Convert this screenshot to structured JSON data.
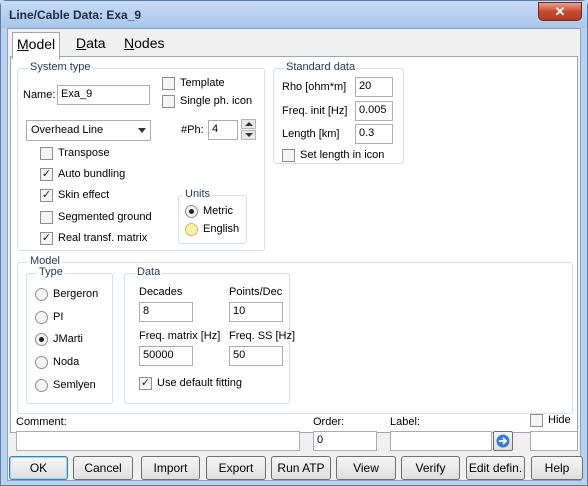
{
  "window": {
    "title": "Line/Cable Data: Exa_9",
    "close_glyph": "✕"
  },
  "tabs": [
    "Model",
    "Data",
    "Nodes"
  ],
  "system_type": {
    "title": "System type",
    "name_label": "Name:",
    "name_value": "Exa_9",
    "template_label": "Template",
    "single_phase_label": "Single ph. icon",
    "line_type": "Overhead Line",
    "phases_label": "#Ph:",
    "phases_value": "4",
    "checks": [
      {
        "label": "Transpose",
        "checked": false
      },
      {
        "label": "Auto bundling",
        "checked": true
      },
      {
        "label": "Skin effect",
        "checked": true
      },
      {
        "label": "Segmented ground",
        "checked": false
      },
      {
        "label": "Real transf. matrix",
        "checked": true
      }
    ],
    "units": {
      "title": "Units",
      "options": [
        "Metric",
        "English"
      ],
      "selected": "Metric"
    }
  },
  "standard_data": {
    "title": "Standard data",
    "rho_label": "Rho [ohm*m]",
    "rho_value": "20",
    "freq_init_label": "Freq. init [Hz]",
    "freq_init_value": "0.005",
    "length_label": "Length [km]",
    "length_value": "0.3",
    "set_length_label": "Set length in icon"
  },
  "model": {
    "title": "Model",
    "type": {
      "title": "Type",
      "options": [
        "Bergeron",
        "PI",
        "JMarti",
        "Noda",
        "Semlyen"
      ],
      "selected": "JMarti"
    },
    "data": {
      "title": "Data",
      "decades_label": "Decades",
      "decades_value": "8",
      "points_label": "Points/Dec",
      "points_value": "10",
      "freq_matrix_label": "Freq. matrix [Hz]",
      "freq_matrix_value": "50000",
      "freq_ss_label": "Freq. SS [Hz]",
      "freq_ss_value": "50",
      "default_fitting_label": "Use default fitting",
      "default_fitting_checked": true
    }
  },
  "footer": {
    "comment_label": "Comment:",
    "comment_value": "",
    "order_label": "Order:",
    "order_value": "0",
    "label_label": "Label:",
    "label_value": "",
    "hide_label": "Hide",
    "hide_value": ""
  },
  "buttons": [
    "OK",
    "Cancel",
    "Import",
    "Export",
    "Run ATP",
    "View",
    "Verify",
    "Edit defin.",
    "Help"
  ],
  "colors": {
    "title_bg": "#b9d1ef",
    "close_red": "#c74b30",
    "group_title": "#1e395b"
  }
}
